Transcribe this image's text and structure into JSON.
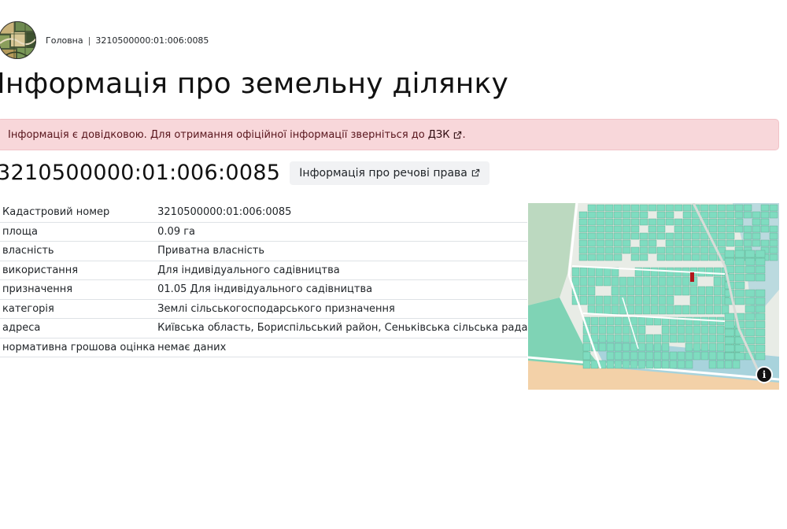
{
  "breadcrumb": {
    "home": "Головна",
    "separator": "|",
    "current": "3210500000:01:006:0085"
  },
  "page_title": "Інформація про земельну ділянку",
  "alert": {
    "text": "Інформація є довідковою. Для отримання офіційної інформації зверніться до",
    "link": "ДЗК",
    "suffix": "."
  },
  "cadastral_number": "3210500000:01:006:0085",
  "rights_button": "Інформація про речові права",
  "table": [
    {
      "key": "Кадастровий номер",
      "value": "3210500000:01:006:0085"
    },
    {
      "key": "площа",
      "value": "0.09 га"
    },
    {
      "key": "власність",
      "value": "Приватна власність"
    },
    {
      "key": "використання",
      "value": "Для індивідуального садівництва"
    },
    {
      "key": "призначення",
      "value": "01.05 Для індивідуального садівництва"
    },
    {
      "key": "категорія",
      "value": "Землі сільськогосподарського призначення"
    },
    {
      "key": "адреса",
      "value": "Київська область, Бориспільський район, Сеньківська сільська рада"
    },
    {
      "key": "нормативна грошова оцінка",
      "value": "немає даних"
    }
  ],
  "map": {
    "info_button": "i",
    "parcel_color": "#7fdcc0",
    "highlight_color": "#b0171b",
    "water_color": "#a8d3dc"
  },
  "icons": {
    "logo": "map-emblem-icon",
    "external": "external-link-icon",
    "map_info": "info-icon"
  }
}
